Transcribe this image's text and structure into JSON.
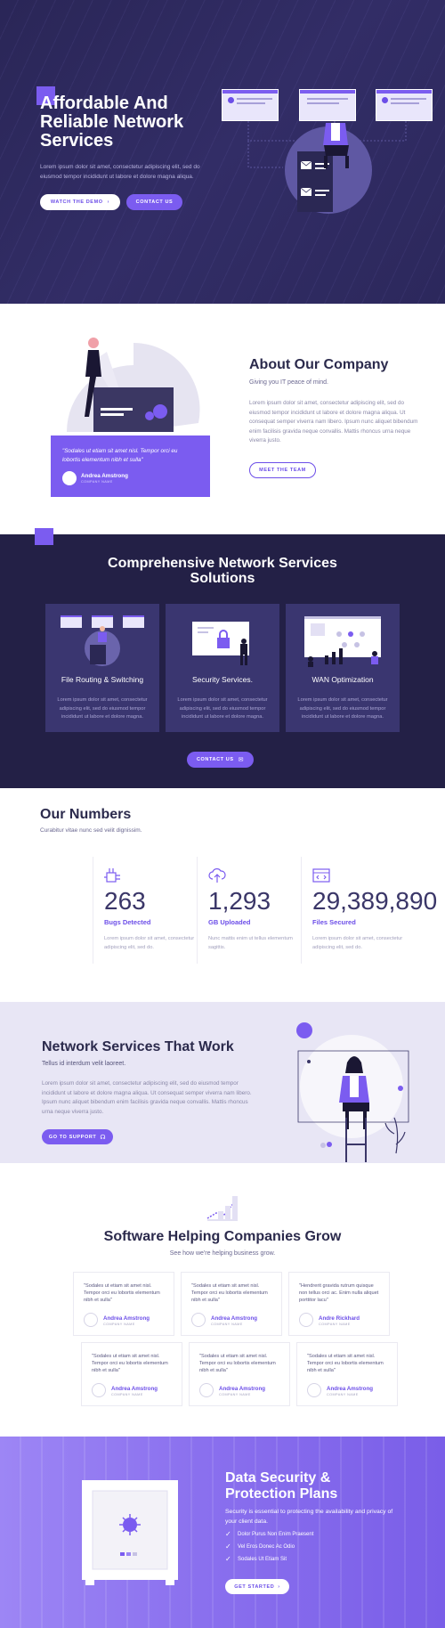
{
  "hero": {
    "title": "Affordable And Reliable Network Services",
    "text": "Lorem ipsum dolor sit amet, consectetur adipiscing elit, sed do eiusmod tempor incididunt ut labore et dolore magna aliqua.",
    "watch_demo": "WATCH THE DEMO",
    "contact_us": "CONTACT US"
  },
  "about": {
    "title": "About Our Company",
    "subtitle": "Giving you IT peace of mind.",
    "text": "Lorem ipsum dolor sit amet, consectetur adipiscing elit, sed do eiusmod tempor incididunt ut labore et dolore magna aliqua. Ut consequat semper viverra nam libero. Ipsum nunc aliquet bibendum enim facilisis gravida neque convallis. Mattis rhoncus urna neque viverra justo.",
    "button": "MEET THE TEAM",
    "quote": "\"Sodales ut etiam sit amet nisl. Tempor orci eu lobortis elementum nibh et sulla\"",
    "author": "Andrea Amstrong",
    "company": "COMPANY NAME"
  },
  "services": {
    "title": "Comprehensive Network Services Solutions",
    "cards": [
      {
        "title": "File Routing & Switching",
        "text": "Lorem ipsum dolor sit amet, consectetur adipiscing elit, sed do eiusmod tempor incididunt ut labore et dolore magna."
      },
      {
        "title": "Security Services.",
        "text": "Lorem ipsum dolor sit amet, consectetur adipiscing elit, sed do eiusmod tempor incididunt ut labore et dolore magna."
      },
      {
        "title": "WAN Optimization",
        "text": "Lorem ipsum dolor sit amet, consectetur adipiscing elit, sed do eiusmod tempor incididunt ut labore et dolore magna."
      }
    ],
    "button": "CONTACT US"
  },
  "numbers": {
    "title": "Our Numbers",
    "subtitle": "Curabitur vitae nunc sed velit dignissim.",
    "items": [
      {
        "value": "263",
        "label": "Bugs Detected",
        "text": "Lorem ipsum dolor sit amet, consectetur adipiscing elit, sed do.",
        "icon": "circuit-icon"
      },
      {
        "value": "1,293",
        "label": "GB Uploaded",
        "text": "Nunc mattis enim ut tellus elementum sagittis.",
        "icon": "cloud-upload-icon"
      },
      {
        "value": "29,389,890",
        "label": "Files Secured",
        "text": "Lorem ipsum dolor sit amet, consectetur adipiscing elit, sed do.",
        "icon": "code-window-icon"
      }
    ]
  },
  "work": {
    "title": "Network Services That Work",
    "subtitle": "Tellus id interdum velit laoreet.",
    "text": "Lorem ipsum dolor sit amet, consectetur adipiscing elit, sed do eiusmod tempor incididunt ut labore et dolore magna aliqua. Ut consequat semper viverra nam libero. Ipsum nunc aliquet bibendum enim facilisis gravida neque convallis. Mattis rhoncus urna neque viverra justo.",
    "button": "GO TO SUPPORT"
  },
  "testimonials": {
    "title": "Software Helping Companies Grow",
    "subtitle": "See how we're helping business grow.",
    "items": [
      {
        "quote": "\"Sodales ut etiam sit amet nisl. Tempor orci eu lobortis elementum nibh et sulla\"",
        "name": "Andrea Amstrong",
        "company": "COMPANY NAME"
      },
      {
        "quote": "\"Sodales ut etiam sit amet nisl. Tempor orci eu lobortis elementum nibh et sulla\"",
        "name": "Andrea Amstrong",
        "company": "COMPANY NAME"
      },
      {
        "quote": "\"Hendrerit gravida rutrum quisque non tellus orci ac. Enim nulla aliquet porttitor lacu\"",
        "name": "Andre Rickhard",
        "company": "COMPANY NAME"
      },
      {
        "quote": "\"Sodales ut etiam sit amet nisl. Tempor orci eu lobortis elementum nibh et sulla\"",
        "name": "Andrea Amstrong",
        "company": "COMPANY NAME"
      },
      {
        "quote": "\"Sodales ut etiam sit amet nisl. Tempor orci eu lobortis elementum nibh et sulla\"",
        "name": "Andrea Amstrong",
        "company": "COMPANY NAME"
      },
      {
        "quote": "\"Sodales ut etiam sit amet nisl. Tempor orci eu lobortis elementum nibh et sulla\"",
        "name": "Andrea Amstrong",
        "company": "COMPANY NAME"
      }
    ]
  },
  "security": {
    "title": "Data Security & Protection Plans",
    "text": "Security is essential to protecting the availability and privacy of your client data.",
    "items": [
      "Dolor Purus Non Enim Praesent",
      "Vel Eros Donec Ac Odio",
      "Sodales Ut Etiam Sit"
    ],
    "button": "GET STARTED"
  },
  "colors": {
    "accent": "#7b5cf0",
    "dark": "#232046",
    "hero": "#2c285c",
    "light": "#e8e6f5"
  }
}
